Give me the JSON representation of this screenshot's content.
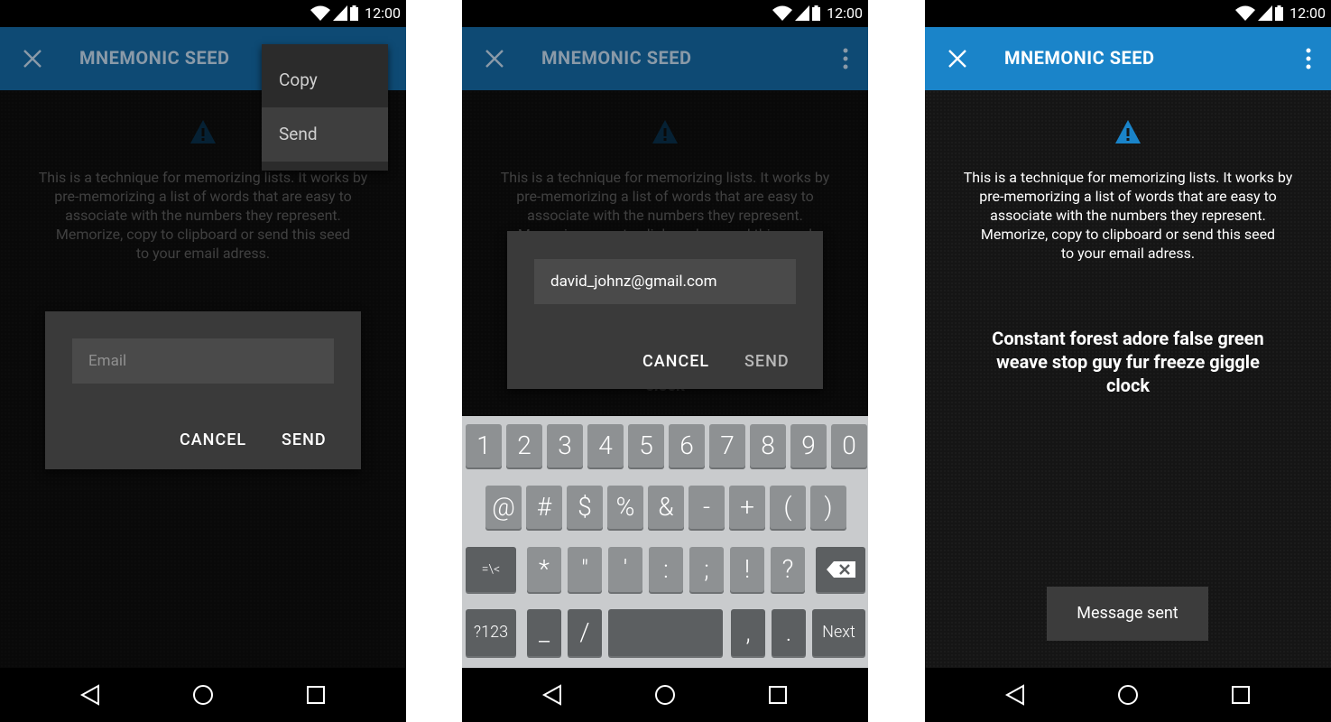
{
  "status": {
    "time": "12:00"
  },
  "toolbar": {
    "title": "MNEMONIC SEED"
  },
  "description": [
    "This is a technique for memorizing lists. It works by",
    "pre-memorizing a list of words that are easy to",
    "associate with the numbers they represent.",
    "Memorize, copy to clipboard or send this seed",
    "to your email adress."
  ],
  "menu": {
    "items": [
      "Copy",
      "Send"
    ]
  },
  "dialog1": {
    "email_placeholder": "Email",
    "cancel": "CANCEL",
    "send": "SEND"
  },
  "dialog2": {
    "email_value": "david_johnz@gmail.com",
    "cancel": "CANCEL",
    "send": "SEND"
  },
  "seed": [
    "Constant forest adore false green",
    "weave stop guy fur freeze giggle",
    "clock"
  ],
  "keyboard": {
    "row1": [
      "1",
      "2",
      "3",
      "4",
      "5",
      "6",
      "7",
      "8",
      "9",
      "0"
    ],
    "row2": [
      "@",
      "#",
      "$",
      "%",
      "&",
      "-",
      "+",
      "(",
      ")"
    ],
    "row3": [
      "=\\<",
      "*",
      "\"",
      "'",
      ":",
      ";",
      "!",
      "?"
    ],
    "row4": [
      "?123",
      "_",
      "/",
      "",
      ",",
      ".",
      "Next"
    ]
  },
  "toast": "Message sent",
  "colors": {
    "toolbar_dimmed": "#0e4a74",
    "toolbar_active": "#1a84c9",
    "warning": "#1a84c9"
  }
}
